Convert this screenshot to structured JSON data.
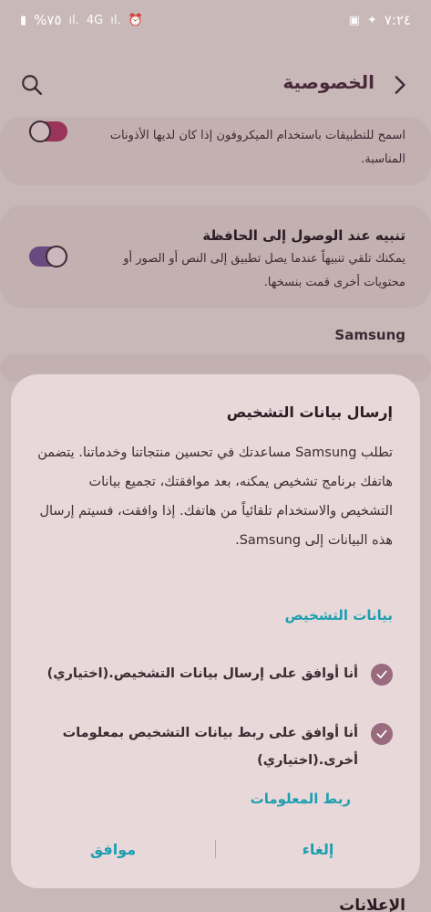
{
  "status_bar": {
    "time": "٧:٢٤",
    "battery": "%٧٥",
    "network": "4G"
  },
  "header": {
    "title": "الخصوصية"
  },
  "settings": {
    "mic_item": {
      "text": "اسمح للتطبيقات باستخدام الميكروفون إذا كان لديها الأذونات المناسبة."
    },
    "clipboard_item": {
      "title": "تنبيه عند الوصول إلى الحافظة",
      "text": "يمكنك تلقي تنبيهاً عندما يصل تطبيق إلى النص أو الصور أو محتويات أخرى قمت بنسخها."
    },
    "section_samsung": "Samsung",
    "bottom_section": "الإعلانات"
  },
  "dialog": {
    "title": "إرسال بيانات التشخيص",
    "body": "تطلب Samsung مساعدتك في تحسين منتجاتنا وخدماتنا. يتضمن هاتفك برنامج تشخيص يمكنه، بعد موافقتك، تجميع بيانات التشخيص والاستخدام تلقائياً من هاتفك. إذا وافقت، فسيتم إرسال هذه البيانات إلى Samsung.",
    "section_link": "بيانات التشخيص",
    "check1": "أنا أوافق على إرسال بيانات التشخيص.(اختياري)",
    "check2": "أنا أوافق على ربط بيانات التشخيص بمعلومات أخرى.(اختياري)",
    "info_link": "ربط المعلومات",
    "cancel": "إلغاء",
    "ok": "موافق"
  },
  "colors": {
    "accent": "#1e9fb0",
    "dialog_bg": "#e8d8d9",
    "check": "#9a6a7e"
  }
}
